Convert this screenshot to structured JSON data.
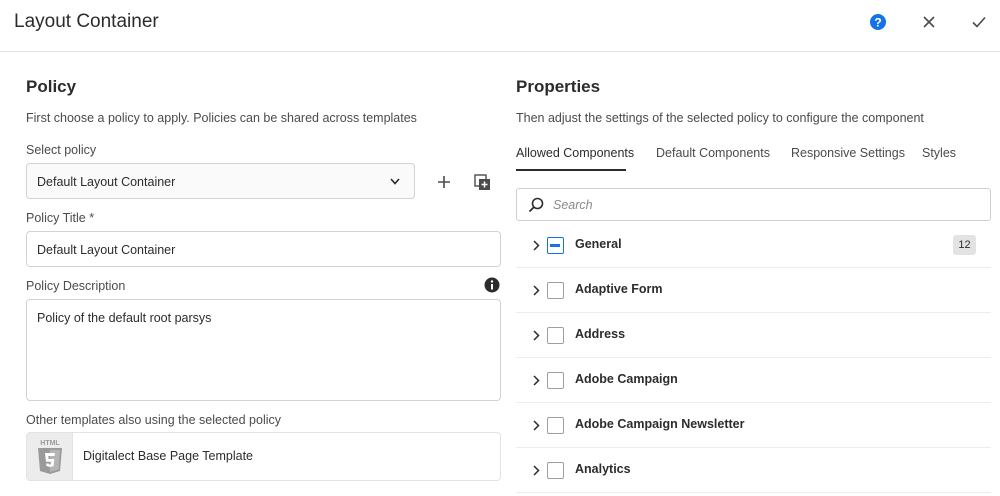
{
  "header": {
    "title": "Layout Container",
    "help_icon": "help-icon",
    "close_icon": "close-icon",
    "done_icon": "checkmark-icon",
    "accent": "#1473e6"
  },
  "policy": {
    "heading": "Policy",
    "description": "First choose a policy to apply. Policies can be shared across templates",
    "select_label": "Select policy",
    "select_value": "Default Layout Container",
    "title_label": "Policy Title *",
    "title_value": "Default Layout Container",
    "description_label": "Policy Description",
    "description_value": "Policy of the default root parsys",
    "templates_label": "Other templates also using the selected policy",
    "template_name": "Digitalect Base Page Template",
    "template_thumb_text": "HTML"
  },
  "properties": {
    "heading": "Properties",
    "description": "Then adjust the settings of the selected policy to configure the component",
    "tabs": [
      {
        "label": "Allowed Components"
      },
      {
        "label": "Default Components"
      },
      {
        "label": "Responsive Settings"
      },
      {
        "label": "Styles"
      }
    ],
    "active_tab": "Allowed Components",
    "search_placeholder": "Search",
    "groups": [
      {
        "label": "General",
        "state": "partial",
        "count": "12"
      },
      {
        "label": "Adaptive Form",
        "state": "unchecked"
      },
      {
        "label": "Address",
        "state": "unchecked"
      },
      {
        "label": "Adobe Campaign",
        "state": "unchecked"
      },
      {
        "label": "Adobe Campaign Newsletter",
        "state": "unchecked"
      },
      {
        "label": "Analytics",
        "state": "unchecked"
      }
    ]
  }
}
